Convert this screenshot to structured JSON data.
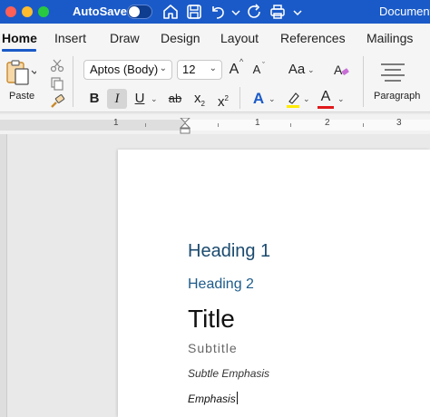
{
  "titlebar": {
    "autosave_label": "AutoSave",
    "autosave_state": "off",
    "document_name": "Document",
    "background_color": "#1a5ac8",
    "icons": [
      "home-icon",
      "save-icon",
      "undo-icon",
      "chevron-down-icon",
      "redo-icon",
      "print-icon",
      "chevron-down-icon"
    ]
  },
  "tabs": [
    {
      "label": "Home",
      "active": true
    },
    {
      "label": "Insert"
    },
    {
      "label": "Draw"
    },
    {
      "label": "Design"
    },
    {
      "label": "Layout"
    },
    {
      "label": "References"
    },
    {
      "label": "Mailings"
    }
  ],
  "ribbon": {
    "paste_label": "Paste",
    "font_name": "Aptos (Body)",
    "font_size": "12",
    "bold": "B",
    "italic": "I",
    "underline": "U",
    "strikethrough": "ab",
    "subscript_base": "x",
    "subscript_mark": "2",
    "superscript_base": "x",
    "superscript_mark": "2",
    "grow_font": "A",
    "shrink_font": "A",
    "change_case": "Aa",
    "text_effects": "A",
    "font_color": "A",
    "paragraph_label": "Paragraph",
    "highlight_color": "#ffeb00",
    "font_color_swatch": "#e0191b",
    "italic_pressed": true
  },
  "ruler": {
    "numbers": [
      "1",
      "1",
      "2",
      "3"
    ]
  },
  "document": {
    "heading1": "Heading 1",
    "heading2": "Heading 2",
    "title": "Title",
    "subtitle": "Subtitle",
    "subtle_emphasis": "Subtle Emphasis",
    "emphasis": "Emphasis"
  }
}
